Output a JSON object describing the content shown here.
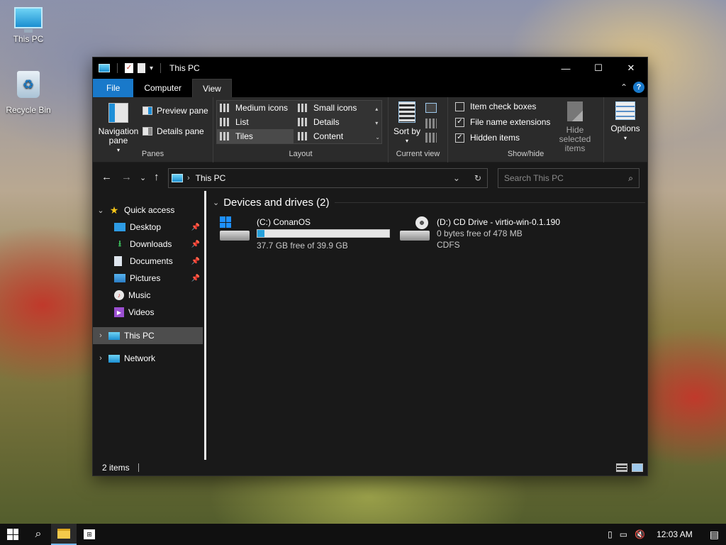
{
  "desktop": {
    "icons": [
      {
        "label": "This PC"
      },
      {
        "label": "Recycle Bin"
      }
    ]
  },
  "window": {
    "title": "This PC",
    "controls": {
      "minimize": "—",
      "maximize": "☐",
      "close": "✕"
    }
  },
  "tabs": {
    "file": "File",
    "computer": "Computer",
    "view": "View",
    "active": "View"
  },
  "ribbon": {
    "panes": {
      "label": "Panes",
      "navigation_pane": "Navigation pane",
      "preview_pane": "Preview pane",
      "details_pane": "Details pane"
    },
    "layout": {
      "label": "Layout",
      "medium_icons": "Medium icons",
      "small_icons": "Small icons",
      "list": "List",
      "details": "Details",
      "tiles": "Tiles",
      "content": "Content",
      "selected": "Tiles"
    },
    "current_view": {
      "label": "Current view",
      "sort_by": "Sort by"
    },
    "show_hide": {
      "label": "Show/hide",
      "item_check_boxes": {
        "label": "Item check boxes",
        "checked": false
      },
      "file_name_extensions": {
        "label": "File name extensions",
        "checked": true
      },
      "hidden_items": {
        "label": "Hidden items",
        "checked": true
      },
      "hide_selected_items": "Hide selected items"
    },
    "options": "Options"
  },
  "address": {
    "path": "This PC",
    "search_placeholder": "Search This PC"
  },
  "nav_pane": {
    "quick_access": "Quick access",
    "items": [
      {
        "label": "Desktop",
        "pinned": true
      },
      {
        "label": "Downloads",
        "pinned": true
      },
      {
        "label": "Documents",
        "pinned": true
      },
      {
        "label": "Pictures",
        "pinned": true
      },
      {
        "label": "Music",
        "pinned": false
      },
      {
        "label": "Videos",
        "pinned": false
      }
    ],
    "this_pc": "This PC",
    "network": "Network",
    "selected": "This PC"
  },
  "content": {
    "group_title": "Devices and drives (2)",
    "drives": [
      {
        "name": "(C:) ConanOS",
        "free_text": "37.7 GB free of 39.9 GB",
        "used_fraction": 0.055
      },
      {
        "name": "(D:) CD Drive - virtio-win-0.1.190",
        "free_text": "0 bytes free of 478 MB",
        "filesystem": "CDFS"
      }
    ]
  },
  "status": {
    "item_count": "2 items"
  },
  "taskbar": {
    "time": "12:03 AM"
  },
  "colors": {
    "accent": "#1979ca",
    "usage_fill": "#26a0da",
    "window_bg": "#191919",
    "ribbon_bg": "#2b2b2b"
  }
}
